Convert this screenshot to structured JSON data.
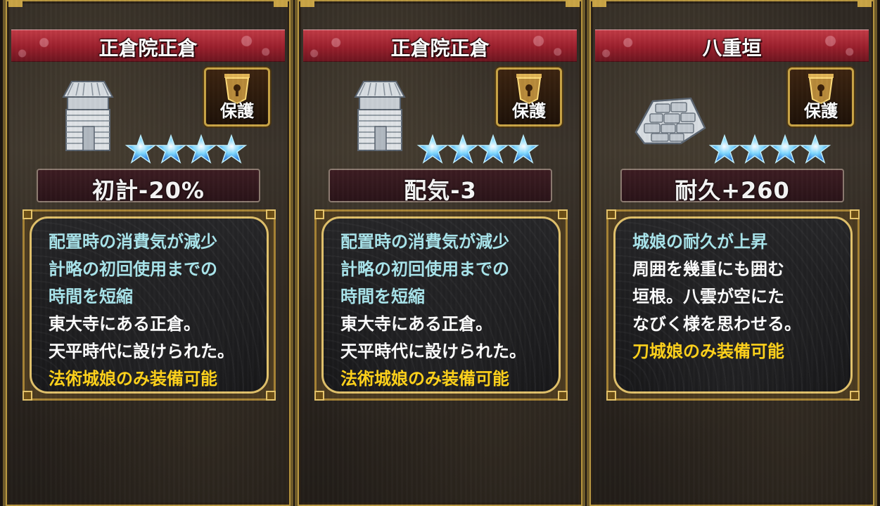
{
  "cards": [
    {
      "title": "正倉院正倉",
      "icon": "storehouse-icon",
      "badge_label": "保護",
      "stars": 4,
      "stat": "初計-20%",
      "desc_lines": [
        {
          "text": "配置時の消費気が減少",
          "color": "cyan"
        },
        {
          "text": "計略の初回使用までの",
          "color": "cyan"
        },
        {
          "text": "時間を短縮",
          "color": "cyan"
        },
        {
          "text": "東大寺にある正倉。",
          "color": "white"
        },
        {
          "text": "天平時代に設けられた。",
          "color": "white"
        },
        {
          "text": "法術城娘のみ装備可能",
          "color": "gold"
        }
      ]
    },
    {
      "title": "正倉院正倉",
      "icon": "storehouse-icon",
      "badge_label": "保護",
      "stars": 4,
      "stat": "配気-3",
      "desc_lines": [
        {
          "text": "配置時の消費気が減少",
          "color": "cyan"
        },
        {
          "text": "計略の初回使用までの",
          "color": "cyan"
        },
        {
          "text": "時間を短縮",
          "color": "cyan"
        },
        {
          "text": "東大寺にある正倉。",
          "color": "white"
        },
        {
          "text": "天平時代に設けられた。",
          "color": "white"
        },
        {
          "text": "法術城娘のみ装備可能",
          "color": "gold"
        }
      ]
    },
    {
      "title": "八重垣",
      "icon": "stone-wall-icon",
      "badge_label": "保護",
      "stars": 4,
      "stat": "耐久+260",
      "desc_lines": [
        {
          "text": "城娘の耐久が上昇",
          "color": "cyan"
        },
        {
          "text": "周囲を幾重にも囲む",
          "color": "white"
        },
        {
          "text": "垣根。八雲が空にた",
          "color": "white"
        },
        {
          "text": "なびく様を思わせる。",
          "color": "white"
        },
        {
          "text": "刀城娘のみ装備可能",
          "color": "gold"
        }
      ]
    }
  ],
  "colors": {
    "cyan": "#a9e5ec",
    "white": "#ffffff",
    "gold": "#ffd21a",
    "title_red": "#9a1f2c",
    "frame_gold": "#c9a445"
  }
}
